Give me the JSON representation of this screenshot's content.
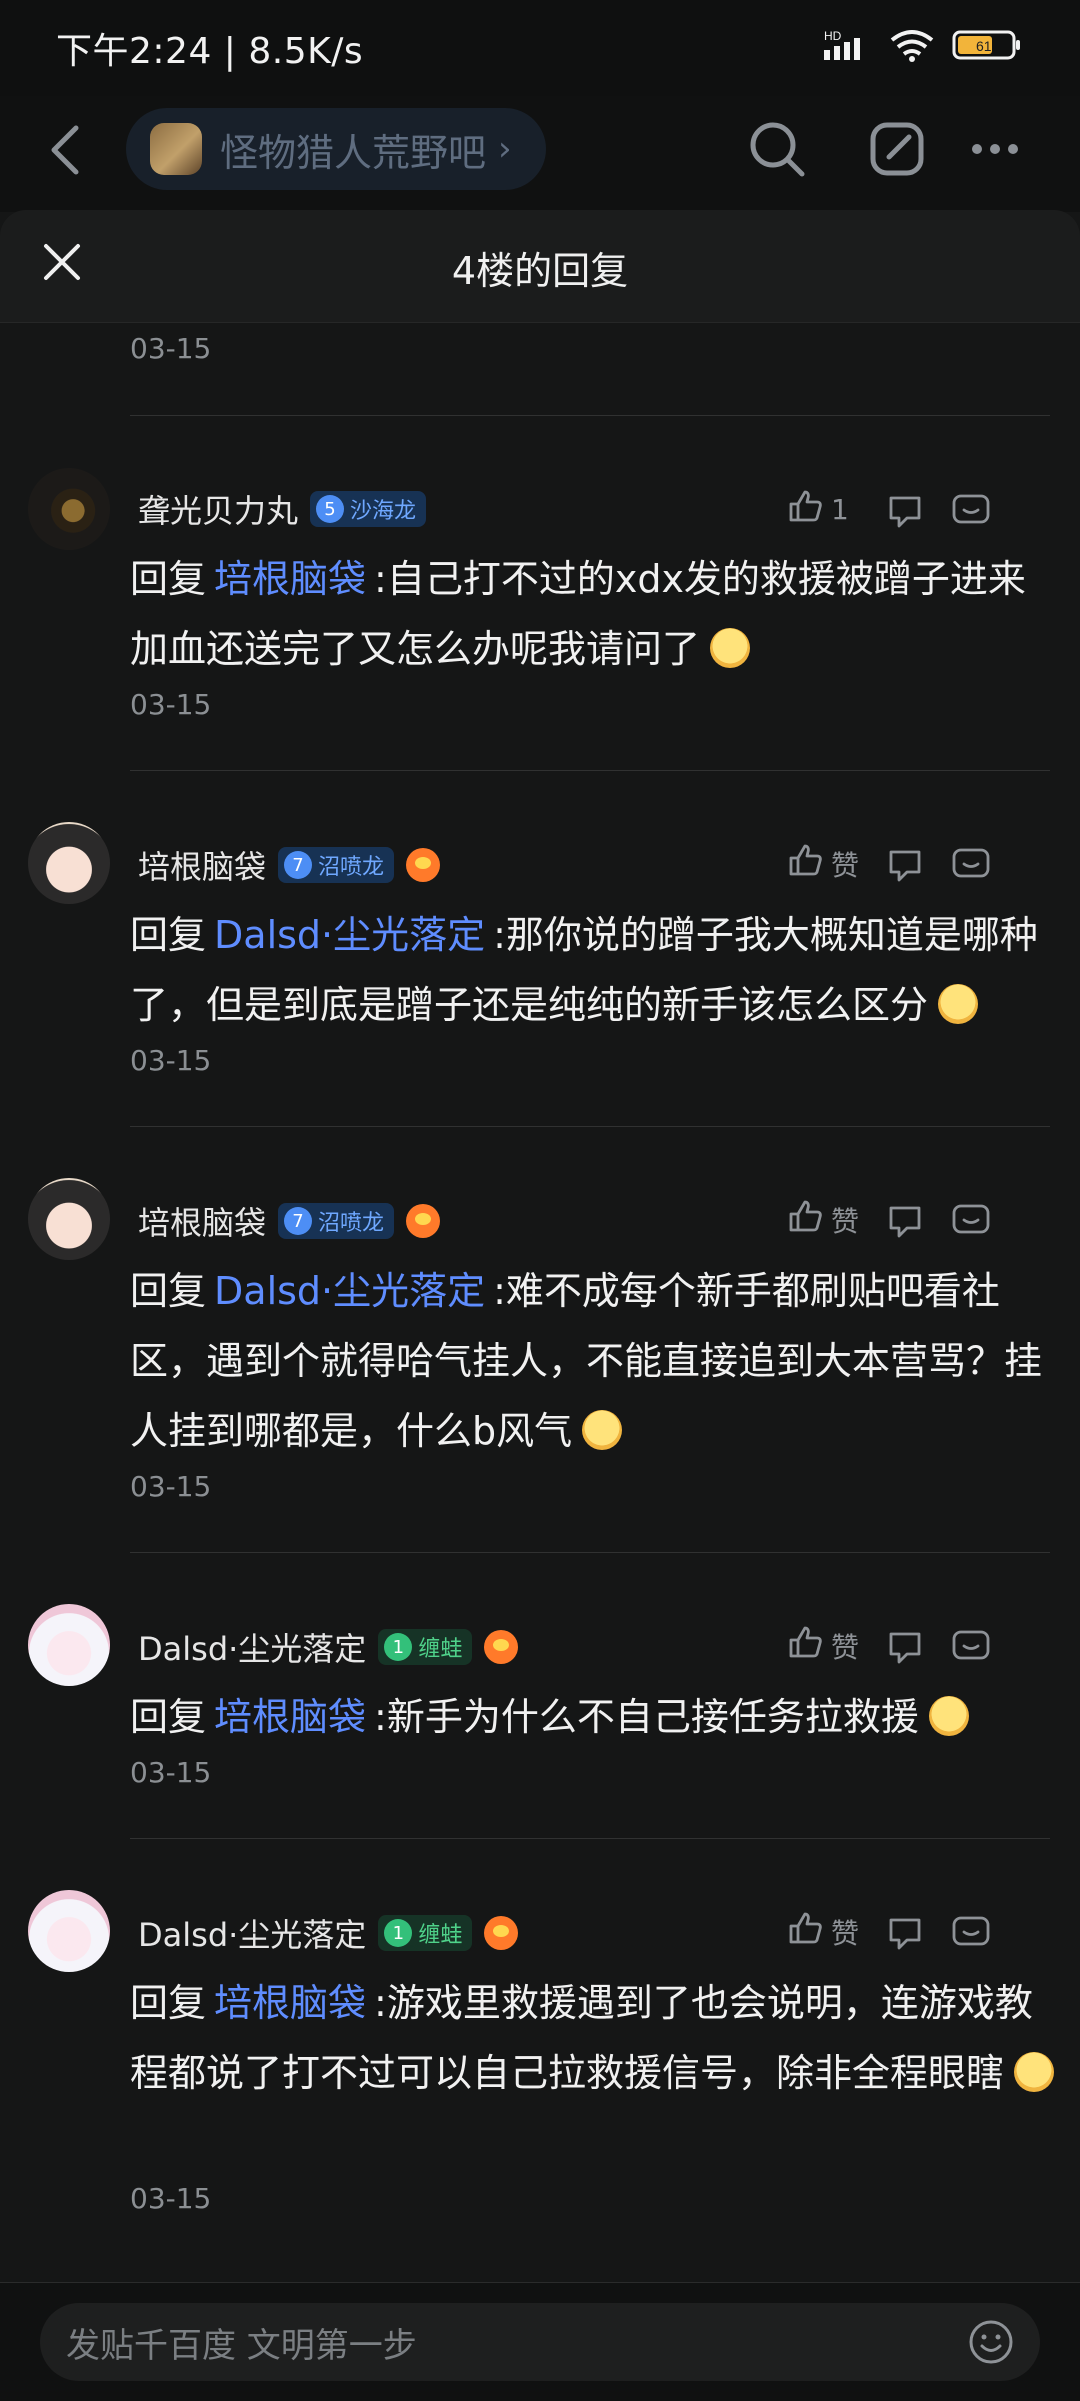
{
  "status_bar": {
    "time_speed": "下午2:24 | 8.5K/s",
    "battery": "61",
    "signal_icon": "signal-hd-icon",
    "wifi_icon": "wifi-icon",
    "battery_icon": "battery-icon"
  },
  "top_bar": {
    "forum_name": "怪物猎人荒野吧",
    "back_icon": "back-chevron-icon",
    "search_icon": "search-icon",
    "compose_icon": "compose-icon",
    "more_icon": "more-icon"
  },
  "sheet": {
    "title": "4楼的回复",
    "close_icon": "close-icon"
  },
  "comments": [
    {
      "date": "03-15"
    },
    {
      "username": "聋光贝力丸",
      "badge_level": "5",
      "badge_name": "沙海龙",
      "badge_color": "#4d8ef5",
      "like_count": "1",
      "reply_prefix": "回复",
      "mention": "培根脑袋",
      "text": ":自己打不过的xdx发的救援被蹭子进来加血还送完了又怎么办呢我请问了",
      "emoji": "thinking-emoji-icon",
      "date": "03-15"
    },
    {
      "username": "培根脑袋",
      "badge_level": "7",
      "badge_name": "沼喷龙",
      "badge_color": "#4d8ef5",
      "game_icon": "game-badge-icon",
      "like_label": "赞",
      "reply_prefix": "回复",
      "mention": "Dalsd·尘光落定",
      "text": ":那你说的蹭子我大概知道是哪种了，但是到底是蹭子还是纯纯的新手该怎么区分",
      "emoji": "grin-emoji-icon",
      "date": "03-15"
    },
    {
      "username": "培根脑袋",
      "badge_level": "7",
      "badge_name": "沼喷龙",
      "badge_color": "#4d8ef5",
      "game_icon": "game-badge-icon",
      "like_label": "赞",
      "reply_prefix": "回复",
      "mention": "Dalsd·尘光落定",
      "text": ":难不成每个新手都刷贴吧看社区，遇到个就得哈气挂人，不能直接追到大本营骂？挂人挂到哪都是，什么b风气",
      "emoji": "grin-emoji-icon",
      "date": "03-15"
    },
    {
      "username": "Dalsd·尘光落定",
      "badge_level": "1",
      "badge_name": "缠蛙",
      "badge_color": "#33c07a",
      "game_icon": "game-badge-icon",
      "like_label": "赞",
      "reply_prefix": "回复",
      "mention": "培根脑袋",
      "text": ":新手为什么不自己接任务拉救援",
      "emoji": "kiss-emoji-icon",
      "date": "03-15"
    },
    {
      "username": "Dalsd·尘光落定",
      "badge_level": "1",
      "badge_name": "缠蛙",
      "badge_color": "#33c07a",
      "game_icon": "game-badge-icon",
      "like_label": "赞",
      "reply_prefix": "回复",
      "mention": "培根脑袋",
      "text": ":游戏里救援遇到了也会说明，连游戏教程都说了打不过可以自己拉救援信号，除非全程眼瞎",
      "emoji": "smile-emoji-icon",
      "date": "03-15"
    }
  ],
  "bottom_bar": {
    "placeholder": "发贴千百度 文明第一步",
    "emoji_icon": "emoji-button-icon"
  }
}
